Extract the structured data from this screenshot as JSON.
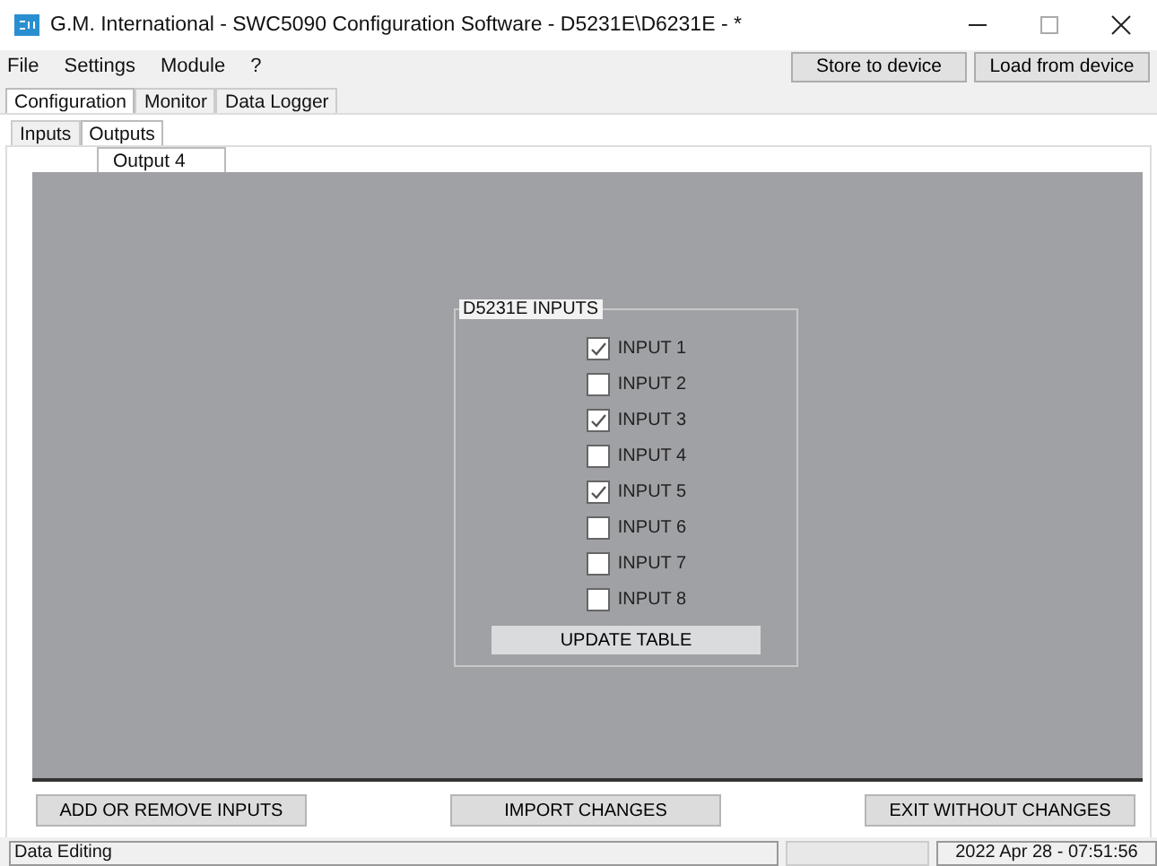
{
  "window": {
    "title": "G.M. International - SWC5090 Configuration Software - D5231E\\D6231E - *"
  },
  "menu": [
    "File",
    "Settings",
    "Module",
    "?"
  ],
  "toolbar_buttons": [
    "Store to device",
    "Load from device"
  ],
  "tabs": [
    {
      "label": "Configuration",
      "selected": true
    },
    {
      "label": "Monitor",
      "selected": false
    },
    {
      "label": "Data Logger",
      "selected": false
    }
  ],
  "subtabs": [
    {
      "label": "Inputs",
      "selected": false
    },
    {
      "label": "Outputs",
      "selected": true
    }
  ],
  "output_tabs": [
    {
      "label": "Output 4",
      "selected": true
    }
  ],
  "group": {
    "title": "D5231E INPUTS",
    "inputs": [
      {
        "label": "INPUT 1",
        "checked": true
      },
      {
        "label": "INPUT 2",
        "checked": false
      },
      {
        "label": "INPUT 3",
        "checked": true
      },
      {
        "label": "INPUT 4",
        "checked": false
      },
      {
        "label": "INPUT 5",
        "checked": true
      },
      {
        "label": "INPUT 6",
        "checked": false
      },
      {
        "label": "INPUT 7",
        "checked": false
      },
      {
        "label": "INPUT 8",
        "checked": false
      }
    ],
    "button": "UPDATE TABLE"
  },
  "bottom_buttons": [
    "ADD OR REMOVE INPUTS",
    "IMPORT CHANGES",
    "EXIT WITHOUT CHANGES"
  ],
  "status_bar": {
    "status": "Data Editing",
    "timestamp": "2022 Apr 28 - 07:51:56"
  }
}
